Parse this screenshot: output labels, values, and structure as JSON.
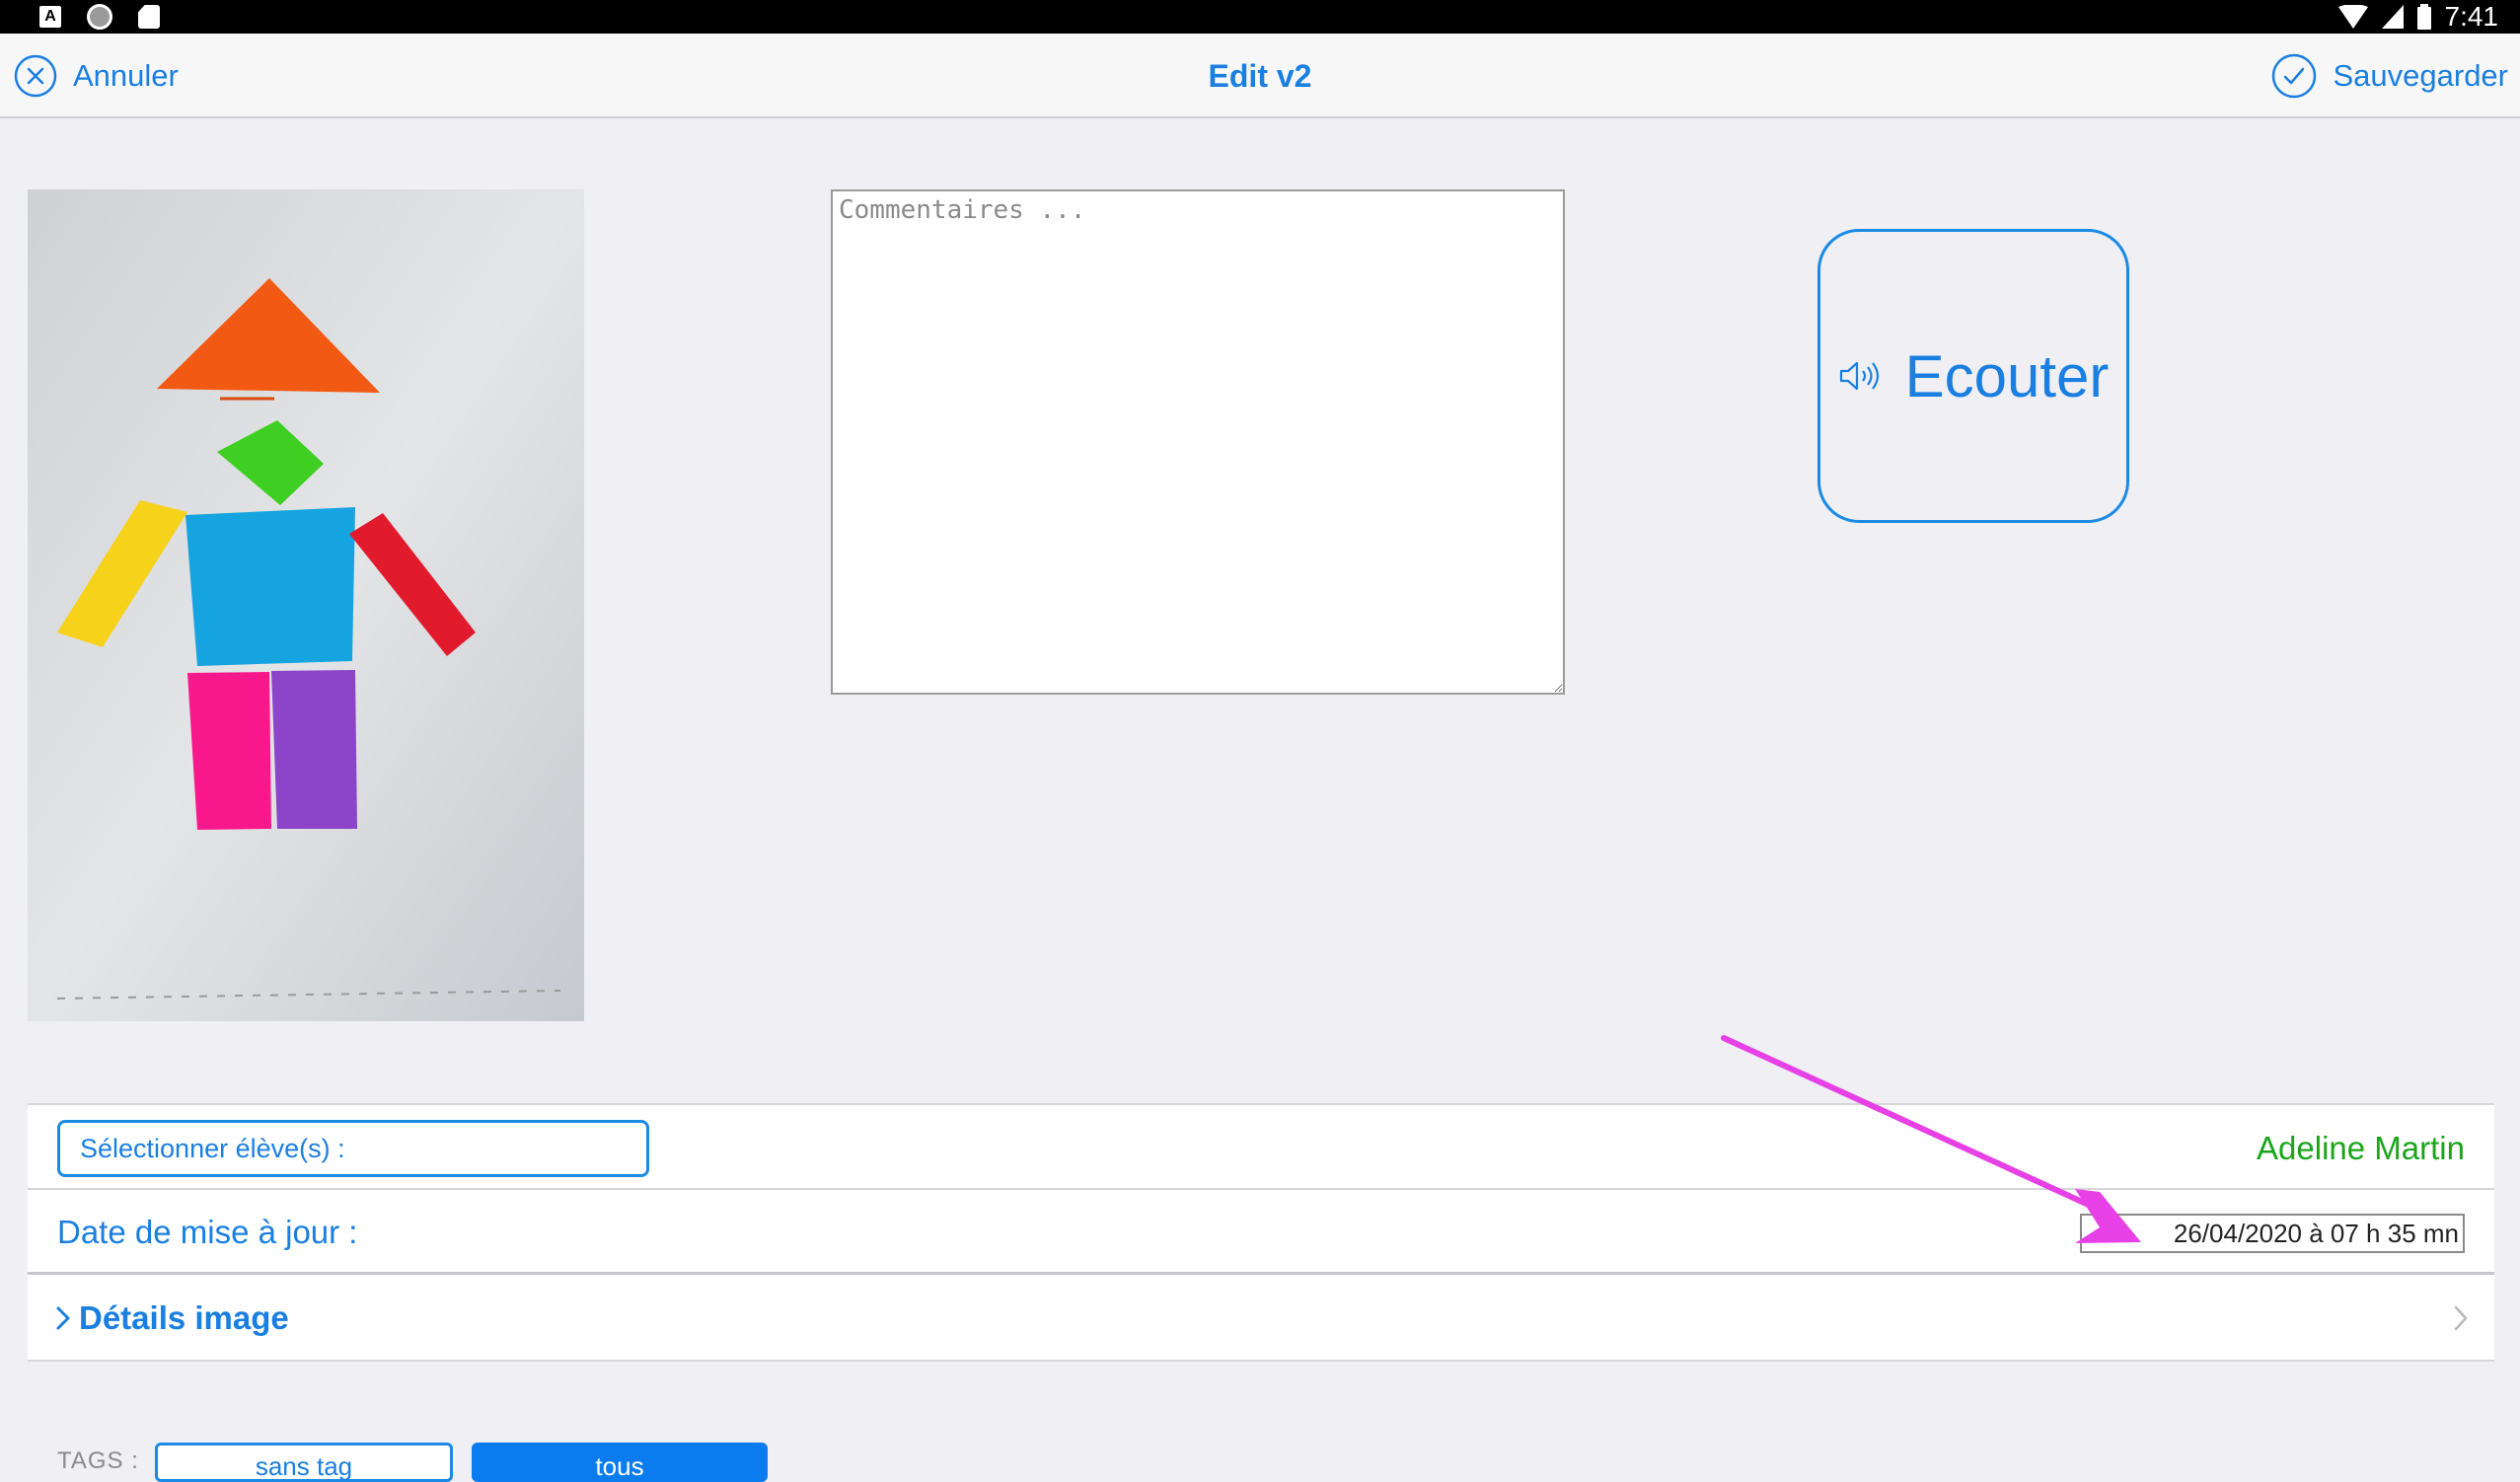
{
  "status_bar": {
    "notification_a": "A",
    "time": "7:41"
  },
  "nav": {
    "cancel_label": "Annuler",
    "title": "Edit v2",
    "save_label": "Sauvegarder"
  },
  "comment": {
    "placeholder": "Commentaires ...",
    "value": ""
  },
  "listen": {
    "label": "Ecouter"
  },
  "form": {
    "select_students_label": "Sélectionner élève(s) :",
    "student_name": "Adeline Martin",
    "date_label": "Date de mise à jour :",
    "date_value": "26/04/2020 à 07 h 35 mn",
    "details_label": "Détails image"
  },
  "tags": {
    "label": "TAGS :",
    "buttons": [
      "sans tag",
      "tous"
    ]
  },
  "colors": {
    "accent": "#1a7fe0",
    "student_name": "#1aa51a",
    "annotation_arrow": "#e640e6",
    "tag_selected_bg": "#0a7cf0"
  }
}
